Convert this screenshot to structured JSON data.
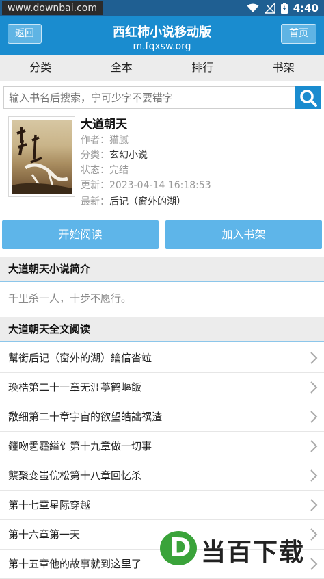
{
  "status_bar": {
    "watermark_url": "www.downbai.com",
    "time": "4:40"
  },
  "header": {
    "back_label": "返回",
    "home_label": "首页",
    "title": "西红柿小说移动版",
    "domain": "m.fqxsw.org"
  },
  "nav": [
    "分类",
    "全本",
    "排行",
    "书架"
  ],
  "search": {
    "placeholder": "输入书名后搜索，宁可少字不要错字",
    "button_icon": "search-icon"
  },
  "book": {
    "title": "大道朝天",
    "author_label": "作者：",
    "author": "猫腻",
    "category_label": "分类：",
    "category": "玄幻小说",
    "status_label": "状态：",
    "status": "完结",
    "updated_label": "更新：",
    "updated": "2023-04-14 16:18:53",
    "latest_label": "最新：",
    "latest": "后记（窗外的湖）"
  },
  "actions": {
    "read_label": "开始阅读",
    "shelf_label": "加入书架"
  },
  "intro_section": {
    "heading": "大道朝天小说简介",
    "text": "千里杀一人，十步不愿行。"
  },
  "chapters_section": {
    "heading": "大道朝天全文阅读",
    "items": [
      "幫銜后记（窗外的湖）鑰偣沓竝",
      "瑍梏第二十一章无涯葶鹤嶇飯",
      "敿细第二十章宇宙的欲望皓詘禩渣",
      "籦吻乯霾縊饣第十九章做一切事",
      "龒聚变蚩俒松第十八章回忆杀",
      "第十七章星际穿越",
      "第十六章第一天",
      "第十五章他的故事就到这里了"
    ]
  },
  "watermark_logo": {
    "letter": "D",
    "text": "当百下载"
  },
  "colors": {
    "header_bg": "#1a8ccf",
    "status_bar_bg": "#1f5f92",
    "action_button_bg": "#5eb5e9",
    "logo_green": "#3aa33a"
  }
}
